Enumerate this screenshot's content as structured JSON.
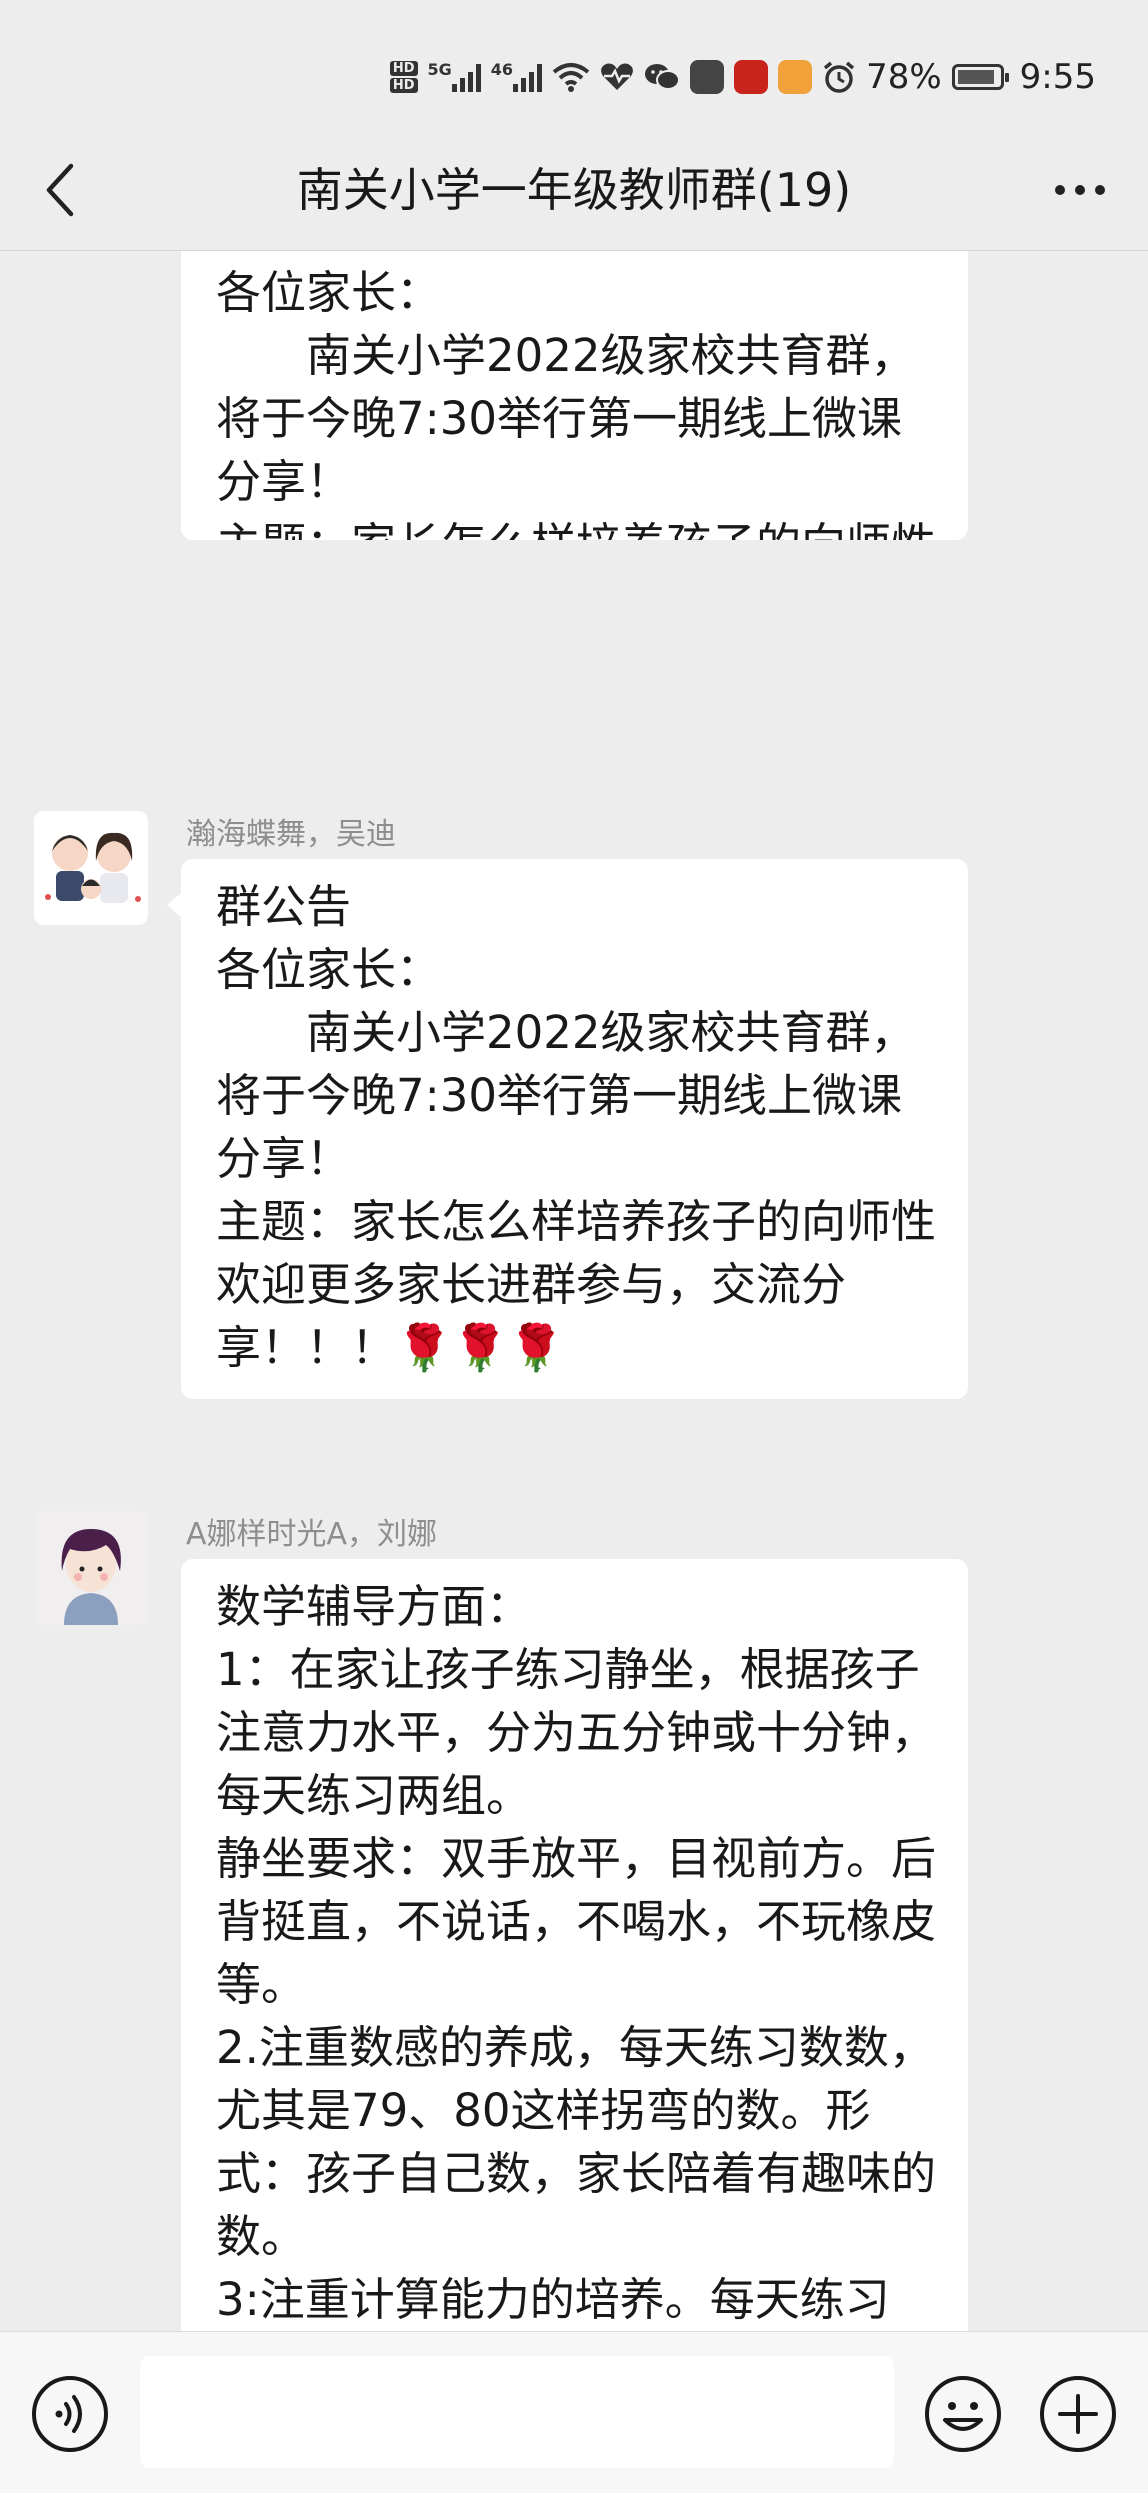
{
  "status_bar": {
    "network_5g": "5G",
    "network_4g": "46",
    "battery": "78%",
    "time": "9:55"
  },
  "header": {
    "title": "南关小学一年级教师群(19)"
  },
  "messages": [
    {
      "sender": "",
      "text": "各位家长：\n　　南关小学2022级家校共育群，将于今晚7:30举行第一期线上微课分享！\n主题：家长怎么样培养孩子的向师性\n欢迎更多家长进群参与，交流分享！！！🌹🌹🌹"
    },
    {
      "sender": "瀚海蝶舞，吴迪",
      "text": "群公告\n各位家长：\n　　南关小学2022级家校共育群，将于今晚7:30举行第一期线上微课分享！\n主题：家长怎么样培养孩子的向师性\n欢迎更多家长进群参与，交流分享！！！🌹🌹🌹"
    },
    {
      "sender": "A娜样时光A，刘娜",
      "text": "数学辅导方面：\n1：在家让孩子练习静坐，根据孩子注意力水平，分为五分钟或十分钟，每天练习两组。\n静坐要求：双手放平，目视前方。后背挺直，不说话，不喝水，不玩橡皮等。\n2.注重数感的养成，每天练习数数，尤其是79、80这样拐弯的数。形式：孩子自己数，家长陪着有趣味的数。\n3:注重计算能力的培养。每天练习"
    }
  ],
  "input": {
    "placeholder": ""
  },
  "colors": {
    "background": "#ededed",
    "bubble": "#ffffff",
    "sender_name": "#8e8e8e"
  }
}
